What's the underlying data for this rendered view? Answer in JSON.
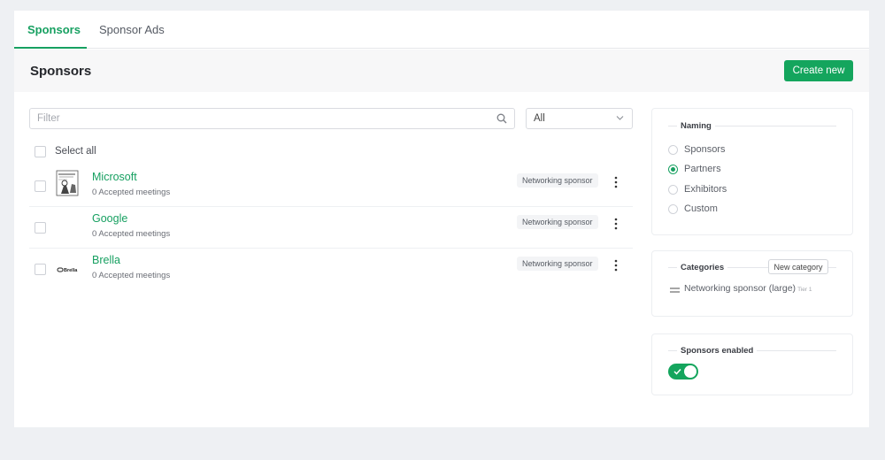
{
  "tabs": [
    {
      "label": "Sponsors",
      "active": true
    },
    {
      "label": "Sponsor Ads",
      "active": false
    }
  ],
  "header": {
    "title": "Sponsors",
    "create_label": "Create new"
  },
  "filter": {
    "placeholder": "Filter",
    "value": ""
  },
  "type_select": {
    "value": "All"
  },
  "select_all_label": "Select all",
  "sponsors": [
    {
      "name": "Microsoft",
      "meta": "0 Accepted meetings",
      "badge": "Networking sponsor",
      "logo": "comic-strip-logo"
    },
    {
      "name": "Google",
      "meta": "0 Accepted meetings",
      "badge": "Networking sponsor",
      "logo": "none"
    },
    {
      "name": "Brella",
      "meta": "0 Accepted meetings",
      "badge": "Networking sponsor",
      "logo": "brella-logo"
    }
  ],
  "naming": {
    "title": "Naming",
    "options": [
      "Sponsors",
      "Partners",
      "Exhibitors",
      "Custom"
    ],
    "selected": "Partners"
  },
  "categories": {
    "title": "Categories",
    "new_label": "New category",
    "items": [
      {
        "label": "Networking sponsor (large)",
        "sub": "Tier 1"
      }
    ]
  },
  "sponsors_enabled": {
    "title": "Sponsors enabled",
    "enabled": true
  },
  "colors": {
    "accent": "#17a061",
    "button": "#14a55d",
    "background": "#eef0f3"
  },
  "brella_logo_text": "Brella"
}
